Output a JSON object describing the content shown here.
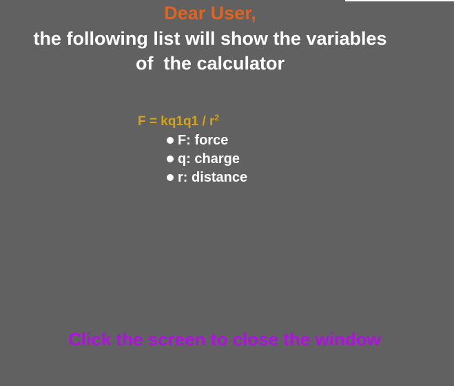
{
  "colors": {
    "background": "#616161",
    "greeting": "#e2631e",
    "intro": "#ffffff",
    "formula": "#d4a418",
    "list_text": "#ffffff",
    "close_hint": "#b10fe3"
  },
  "header": {
    "greeting": "Dear User,",
    "intro_line_1": "the following list will show the variables",
    "intro_line_2": "of  the calculator"
  },
  "formula": {
    "text": "F = kq1q1 / r",
    "exponent": "2"
  },
  "variables": [
    {
      "label": "F: force"
    },
    {
      "label": "q: charge"
    },
    {
      "label": "r: distance"
    }
  ],
  "footer": {
    "close_hint": "Click the screen to close the window"
  }
}
